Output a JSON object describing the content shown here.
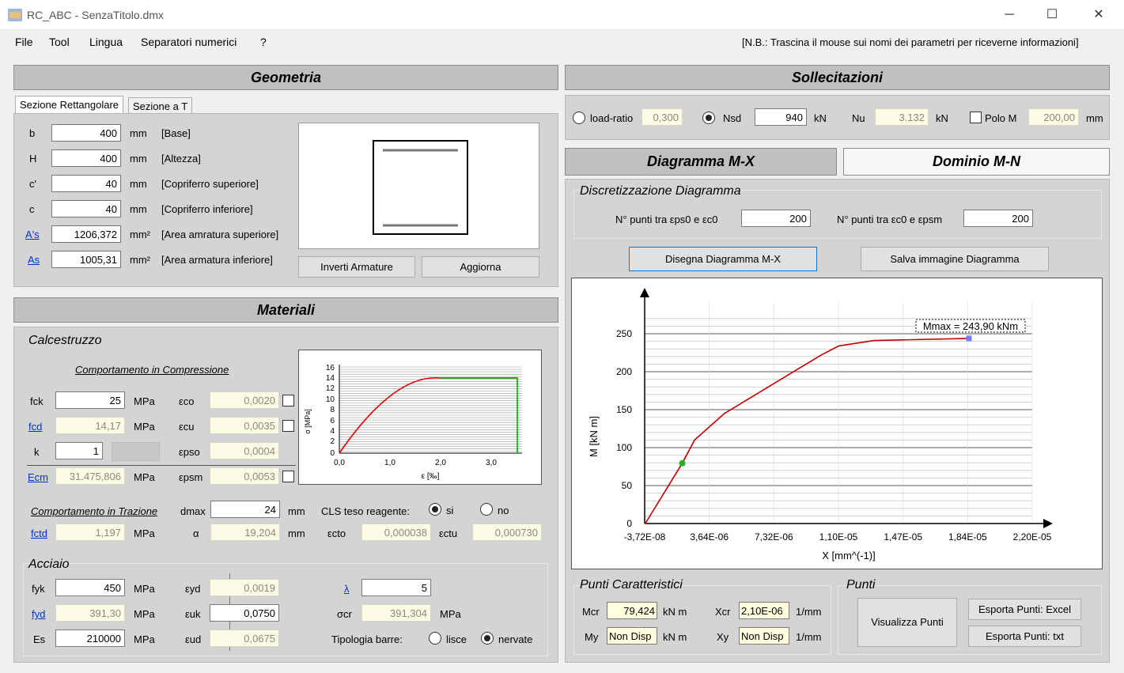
{
  "window": {
    "title": "RC_ABC - SenzaTitolo.dmx",
    "min": "─",
    "max": "☐",
    "close": "✕"
  },
  "menu": {
    "file": "File",
    "tool": "Tool",
    "lingua": "Lingua",
    "separatori": "Separatori numerici",
    "help": "?",
    "note": "[N.B.: Trascina il mouse sui nomi dei parametri per riceverne informazioni]"
  },
  "geometria": {
    "header": "Geometria",
    "tab1": "Sezione Rettangolare",
    "tab2": "Sezione a T",
    "rows": [
      {
        "name": "b",
        "value": "400",
        "unit": "mm",
        "desc": "[Base]"
      },
      {
        "name": "H",
        "value": "400",
        "unit": "mm",
        "desc": "[Altezza]"
      },
      {
        "name": "c'",
        "value": "40",
        "unit": "mm",
        "desc": "[Copriferro superiore]"
      },
      {
        "name": "c",
        "value": "40",
        "unit": "mm",
        "desc": "[Copriferro inferiore]"
      },
      {
        "name": "A's",
        "value": "1206,372",
        "unit": "mm²",
        "desc": "[Area amratura superiore]"
      },
      {
        "name": "As",
        "value": "1005,31",
        "unit": "mm²",
        "desc": "[Area armatura inferiore]"
      }
    ],
    "btn_invert": "Inverti Armature",
    "btn_update": "Aggiorna"
  },
  "materiali": {
    "header": "Materiali",
    "calcestruzzo": "Calcestruzzo",
    "compressione": "Comportamento in Compressione",
    "fck": {
      "label": "fck",
      "value": "25",
      "unit": "MPa"
    },
    "fcd": {
      "label": "fcd",
      "value": "14,17",
      "unit": "MPa"
    },
    "k": {
      "label": "k",
      "value": "1"
    },
    "ecm": {
      "label": "Ecm",
      "value": "31.475,806",
      "unit": "MPa"
    },
    "eco": {
      "label": "εco",
      "value": "0,0020"
    },
    "ecu": {
      "label": "εcu",
      "value": "0,0035"
    },
    "epso": {
      "label": "εpso",
      "value": "0,0004"
    },
    "epsm": {
      "label": "εpsm",
      "value": "0,0053"
    },
    "trazione": "Comportamento in Trazione",
    "dmax": {
      "label": "dmax",
      "value": "24",
      "unit": "mm"
    },
    "cls": {
      "label": "CLS teso reagente:",
      "si": "si",
      "no": "no"
    },
    "fctd": {
      "label": "fctd",
      "value": "1,197",
      "unit": "MPa"
    },
    "alpha": {
      "label": "α",
      "value": "19,204",
      "unit": "mm"
    },
    "ecto": {
      "label": "εcto",
      "value": "0,000038"
    },
    "ectu": {
      "label": "εctu",
      "value": "0,000730"
    },
    "acciaio": "Acciaio",
    "fyk": {
      "label": "fyk",
      "value": "450",
      "unit": "MPa"
    },
    "fyd": {
      "label": "fyd",
      "value": "391,30",
      "unit": "MPa"
    },
    "es": {
      "label": "Es",
      "value": "210000",
      "unit": "MPa"
    },
    "eyd": {
      "label": "εyd",
      "value": "0,0019"
    },
    "euk": {
      "label": "εuk",
      "value": "0,0750"
    },
    "eud": {
      "label": "εud",
      "value": "0,0675"
    },
    "lambda": {
      "label": "λ",
      "value": "5"
    },
    "scr": {
      "label": "σcr",
      "value": "391,304",
      "unit": "MPa"
    },
    "tipologia": {
      "label": "Tipologia barre:",
      "lisce": "lisce",
      "nervate": "nervate"
    },
    "mini_chart": {
      "ylabel": "σ [MPa]",
      "xlabel": "ε [‰]",
      "yticks": [
        "16",
        "14",
        "12",
        "10",
        "8",
        "6",
        "4",
        "2",
        "0"
      ],
      "xticks": [
        "0,0",
        "1,0",
        "2,0",
        "3,0"
      ]
    }
  },
  "sollecitazioni": {
    "header": "Sollecitazioni",
    "load_ratio": {
      "label": "load-ratio",
      "value": "0,300"
    },
    "nsd": {
      "label": "Nsd",
      "value": "940",
      "unit": "kN"
    },
    "nu": {
      "label": "Nu",
      "value": "3.132",
      "unit": "kN"
    },
    "polo": {
      "label": "Polo M",
      "value": "200,00",
      "unit": "mm"
    }
  },
  "tabs": {
    "mx": "Diagramma M-X",
    "mn": "Dominio M-N"
  },
  "discretizzazione": {
    "title": "Discretizzazione Diagramma",
    "p1": {
      "label": "N° punti tra εps0 e εc0",
      "value": "200"
    },
    "p2": {
      "label": "N° punti tra εc0 e εpsm",
      "value": "200"
    },
    "btn_draw": "Disegna Diagramma M-X",
    "btn_save": "Salva immagine Diagramma"
  },
  "chart_data": {
    "type": "line",
    "xlabel": "X [mm^(-1)]",
    "ylabel": "M [kN m]",
    "xticks": [
      "-3,72E-08",
      "3,64E-06",
      "7,32E-06",
      "1,10E-05",
      "1,47E-05",
      "1,84E-05",
      "2,20E-05"
    ],
    "yticks": [
      "0",
      "50",
      "100",
      "150",
      "200",
      "250"
    ],
    "xlim": [
      -3.72e-08,
      2.2e-05
    ],
    "ylim": [
      0,
      270
    ],
    "annotation": "Mmax = 243,90 kNm",
    "series": [
      {
        "x": [
          0,
          2.1e-06,
          2.8e-06,
          4.5e-06,
          7e-06,
          1e-05,
          1.1e-05,
          1.3e-05,
          1.84e-05
        ],
        "y": [
          0,
          79.4,
          110,
          145,
          180,
          222,
          234,
          241,
          243.9
        ]
      }
    ],
    "cracking_point": {
      "x": 2.1e-06,
      "y": 79.424
    },
    "max_point": {
      "x": 1.84e-05,
      "y": 243.9
    }
  },
  "punti_caratteristici": {
    "title": "Punti Caratteristici",
    "mcr": {
      "label": "Mcr",
      "value": "79,424",
      "unit": "kN m"
    },
    "my": {
      "label": "My",
      "value": "Non Disp",
      "unit": "kN m"
    },
    "xcr": {
      "label": "Xcr",
      "value": "2,10E-06",
      "unit": "1/mm"
    },
    "xy": {
      "label": "Xy",
      "value": "Non Disp",
      "unit": "1/mm"
    }
  },
  "punti": {
    "title": "Punti",
    "visualizza": "Visualizza Punti",
    "excel": "Esporta Punti: Excel",
    "txt": "Esporta Punti: txt"
  }
}
